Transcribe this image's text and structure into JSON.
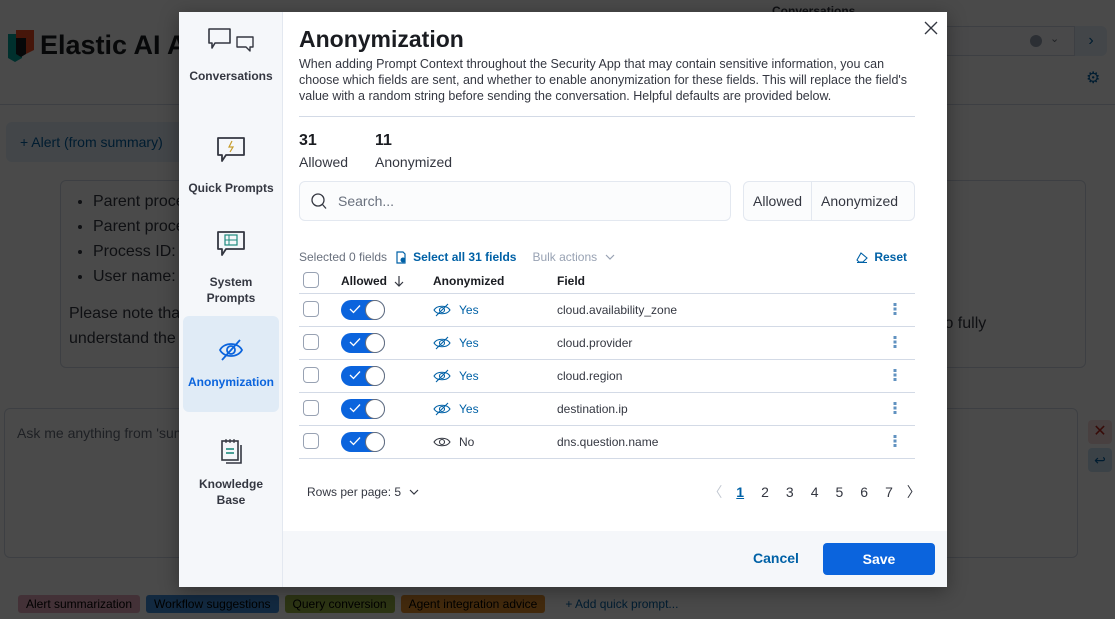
{
  "background": {
    "app_title": "Elastic AI Assistant",
    "conversations_label": "Conversations",
    "alert_badge": "+ Alert (from summary)",
    "message_items": [
      "Parent process",
      "Parent process",
      "Process ID:",
      "User name:"
    ],
    "message_note": "Please note that",
    "message_note_line2": "understand the",
    "message_note_end": "to fully",
    "input_placeholder": "Ask me anything from 'summary'",
    "quick_prompts": [
      {
        "label": "Alert summarization",
        "color": "#e7a8bd"
      },
      {
        "label": "Workflow suggestions",
        "color": "#3e8fdb"
      },
      {
        "label": "Query conversion",
        "color": "#9bb646"
      },
      {
        "label": "Agent integration advice",
        "color": "#e8902e"
      }
    ],
    "add_quick_prompt": "+ Add quick prompt..."
  },
  "sidebar": {
    "items": [
      {
        "label": "Conversations",
        "icon": "conversations-icon",
        "active": false
      },
      {
        "label": "Quick Prompts",
        "icon": "quick-prompts-icon",
        "active": false
      },
      {
        "label_line1": "System",
        "label_line2": "Prompts",
        "icon": "system-prompts-icon",
        "active": false
      },
      {
        "label": "Anonymization",
        "icon": "anonymization-icon",
        "active": true
      },
      {
        "label_line1": "Knowledge",
        "label_line2": "Base",
        "icon": "knowledge-base-icon",
        "active": false
      }
    ]
  },
  "panel": {
    "title": "Anonymization",
    "description": "When adding Prompt Context throughout the Security App that may contain sensitive information, you can choose which fields are sent, and whether to enable anonymization for these fields. This will replace the field's value with a random string before sending the conversation. Helpful defaults are provided below.",
    "stats": [
      {
        "value": "31",
        "label": "Allowed"
      },
      {
        "value": "11",
        "label": "Anonymized"
      }
    ],
    "search_placeholder": "Search...",
    "filters": [
      "Allowed",
      "Anonymized"
    ],
    "toolbar": {
      "selected": "Selected 0 fields",
      "select_all": "Select all 31 fields",
      "bulk_actions": "Bulk actions",
      "reset": "Reset"
    },
    "table": {
      "columns": [
        "Allowed",
        "Anonymized",
        "Field"
      ],
      "rows": [
        {
          "allowed": true,
          "anonymized": "Yes",
          "field": "cloud.availability_zone"
        },
        {
          "allowed": true,
          "anonymized": "Yes",
          "field": "cloud.provider"
        },
        {
          "allowed": true,
          "anonymized": "Yes",
          "field": "cloud.region"
        },
        {
          "allowed": true,
          "anonymized": "Yes",
          "field": "destination.ip"
        },
        {
          "allowed": true,
          "anonymized": "No",
          "field": "dns.question.name"
        }
      ]
    },
    "pagination": {
      "rows_per_page": "Rows per page: 5",
      "pages": [
        "1",
        "2",
        "3",
        "4",
        "5",
        "6",
        "7"
      ],
      "current": "1"
    },
    "footer": {
      "cancel": "Cancel",
      "save": "Save"
    }
  },
  "colors": {
    "primary": "#0b64dd",
    "link": "#0061a6",
    "active_nav_bg": "#e0ebf6"
  }
}
